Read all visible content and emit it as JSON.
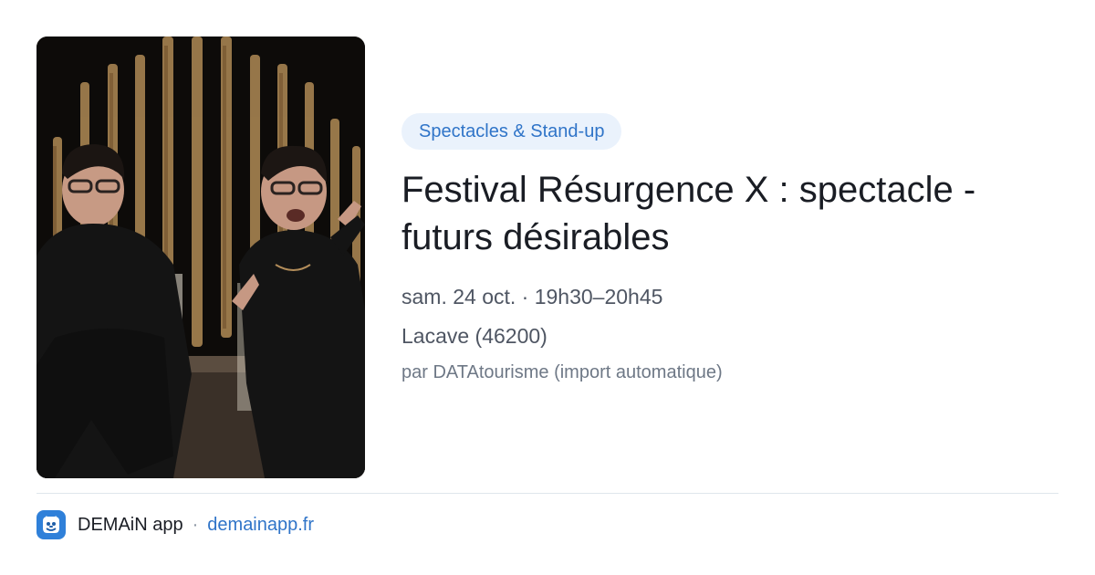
{
  "event": {
    "category": "Spectacles & Stand-up",
    "title": "Festival Résurgence X : spectacle - futurs désirables",
    "datetime": "sam. 24 oct. · 19h30–20h45",
    "location": "Lacave (46200)",
    "source": "par DATAtourisme (import automatique)"
  },
  "footer": {
    "app_name": "DEMAiN app",
    "separator": "·",
    "domain": "demainapp.fr"
  },
  "colors": {
    "accent": "#2f74c8",
    "tag_background": "#eaf2fc",
    "title": "#1a1d24",
    "meta": "#4f5663",
    "divider": "#dfe6ec"
  },
  "icons": {
    "app_logo": "demain-app-icon"
  }
}
